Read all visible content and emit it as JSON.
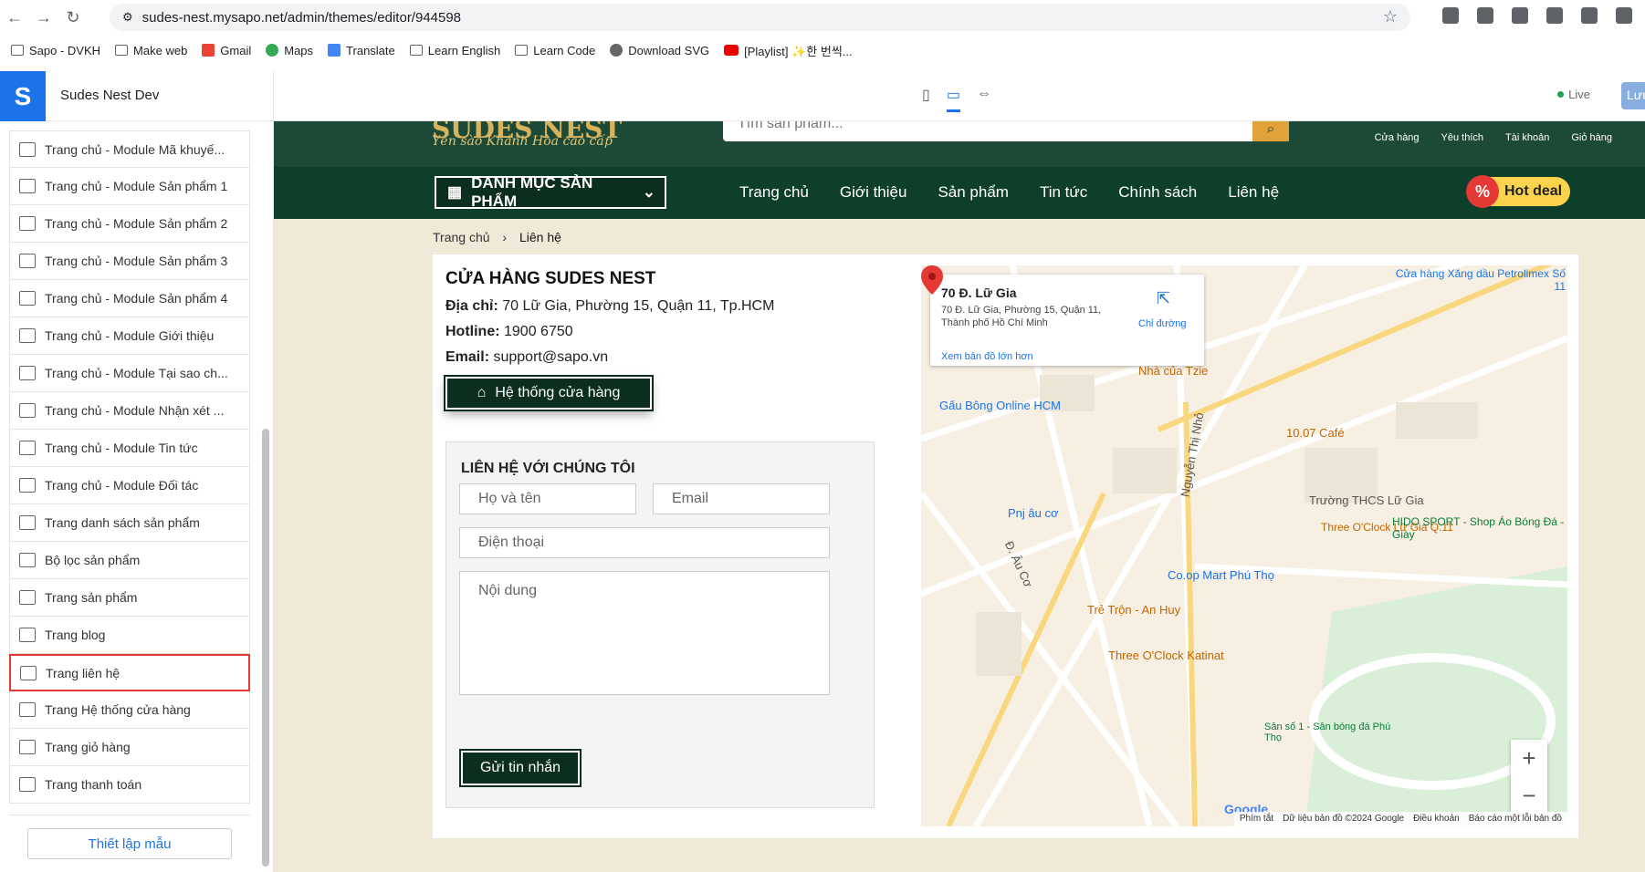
{
  "browser": {
    "url": "sudes-nest.mysapo.net/admin/themes/editor/944598",
    "bookmarks": [
      "Sapo - DVKH",
      "Make web",
      "Gmail",
      "Maps",
      "Translate",
      "Learn English",
      "Learn Code",
      "Download SVG",
      "[Playlist] ✨한 번씩..."
    ]
  },
  "editor": {
    "store_name": "Sudes Nest Dev",
    "live_label": "Live",
    "save_label": "Lưu",
    "template_button": "Thiết lập mẫu",
    "sidebar_items": [
      {
        "label": "Trang chủ - Module Mã khuyế...",
        "icon": "layout-icon"
      },
      {
        "label": "Trang chủ - Module Sản phẩm 1",
        "icon": "layout-icon"
      },
      {
        "label": "Trang chủ - Module Sản phẩm 2",
        "icon": "layout-icon"
      },
      {
        "label": "Trang chủ - Module Sản phẩm 3",
        "icon": "layout-icon"
      },
      {
        "label": "Trang chủ - Module Sản phẩm 4",
        "icon": "layout-icon"
      },
      {
        "label": "Trang chủ - Module Giới thiệu",
        "icon": "layout-icon"
      },
      {
        "label": "Trang chủ - Module Tại sao ch...",
        "icon": "layout-icon"
      },
      {
        "label": "Trang chủ - Module Nhận xét ...",
        "icon": "layout-icon"
      },
      {
        "label": "Trang chủ - Module Tin tức",
        "icon": "layout-icon"
      },
      {
        "label": "Trang chủ - Module Đối tác",
        "icon": "layout-icon"
      },
      {
        "label": "Trang danh sách sản phẩm",
        "icon": "tag-icon"
      },
      {
        "label": "Bộ lọc sản phẩm",
        "icon": "tag-icon"
      },
      {
        "label": "Trang sản phẩm",
        "icon": "tag-icon"
      },
      {
        "label": "Trang blog",
        "icon": "hand-icon"
      },
      {
        "label": "Trang liên hệ",
        "icon": "hand-icon"
      },
      {
        "label": "Trang Hệ thống cửa hàng",
        "icon": "hand-icon"
      },
      {
        "label": "Trang giỏ hàng",
        "icon": "hand-icon"
      },
      {
        "label": "Trang thanh toán",
        "icon": "printer-icon"
      }
    ],
    "active_item": "Trang liên hệ"
  },
  "site": {
    "brand": "SUDES NEST",
    "tagline": "Yến sào Khánh Hòa cao cấp",
    "search_placeholder": "Tìm sản phẩm...",
    "header_links": [
      "Cửa hàng",
      "Yêu thích",
      "Tài khoản",
      "Giỏ hàng"
    ],
    "category_button": "DANH MỤC SẢN PHẨM",
    "nav": [
      "Trang chủ",
      "Giới thiệu",
      "Sản phẩm",
      "Tin tức",
      "Chính sách",
      "Liên hệ"
    ],
    "hot_deal": "Hot deal",
    "breadcrumb": {
      "home": "Trang chủ",
      "current": "Liên hệ"
    },
    "store": {
      "title": "CỬA HÀNG SUDES NEST",
      "address_label": "Địa chỉ:",
      "address": "70 Lữ Gia, Phường 15, Quận 11, Tp.HCM",
      "hotline_label": "Hotline:",
      "hotline": "1900 6750",
      "email_label": "Email:",
      "email": "support@sapo.vn",
      "stores_button": "Hệ thống cửa hàng"
    },
    "form": {
      "title": "LIÊN HỆ VỚI CHÚNG TÔI",
      "name_placeholder": "Họ và tên",
      "email_placeholder": "Email",
      "phone_placeholder": "Điện thoại",
      "message_placeholder": "Nội dung",
      "submit": "Gửi tin nhắn"
    },
    "map": {
      "place_title": "70 Đ. Lữ Gia",
      "place_address": "70 Đ. Lữ Gia, Phường 15, Quận 11, Thành phố Hồ Chí Minh",
      "directions": "Chỉ đường",
      "larger_map": "Xem bản đồ lớn hơn",
      "labels": [
        "Nhà của Tzie",
        "Gấu Bông Online HCM",
        "10.07 Café",
        "Trường THCS Lữ Gia",
        "Co.op Mart Phú Thọ",
        "Pnj âu cơ",
        "Trẻ Trộn - An Huy",
        "Three O'Clock Katinat",
        "Three O'Clock Lữ Gia Q.11",
        "HIDO SPORT - Shop Áo Bóng Đá - Giày",
        "Cửa hàng Xăng dầu Petrolimex Số 11",
        "Nguyễn Thị Nhỏ",
        "Đ. Âu Cơ",
        "Sân số 1 - Sân bóng đá Phú Thọ"
      ],
      "footer": [
        "Phím tắt",
        "Dữ liệu bản đồ ©2024 Google",
        "Điều khoản",
        "Báo cáo một lỗi bản đồ"
      ],
      "google": "Google"
    }
  }
}
